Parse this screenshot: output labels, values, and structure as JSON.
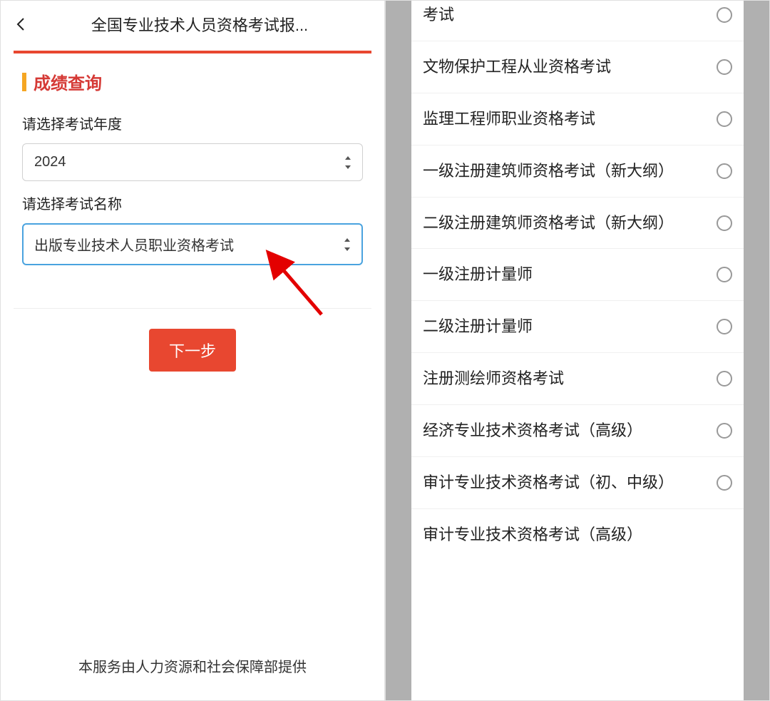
{
  "left": {
    "header_title": "全国专业技术人员资格考试报...",
    "section_title": "成绩查询",
    "year_label": "请选择考试年度",
    "year_value": "2024",
    "exam_label": "请选择考试名称",
    "exam_value": "出版专业技术人员职业资格考试",
    "next_button": "下一步",
    "footer": "本服务由人力资源和社会保障部提供"
  },
  "right": {
    "top_cut_item": "考试",
    "options": [
      "文物保护工程从业资格考试",
      "监理工程师职业资格考试",
      "一级注册建筑师资格考试（新大纲）",
      "二级注册建筑师资格考试（新大纲）",
      "一级注册计量师",
      "二级注册计量师",
      "注册测绘师资格考试",
      "经济专业技术资格考试（高级）",
      "审计专业技术资格考试（初、中级）",
      "审计专业技术资格考试（高级）"
    ]
  }
}
